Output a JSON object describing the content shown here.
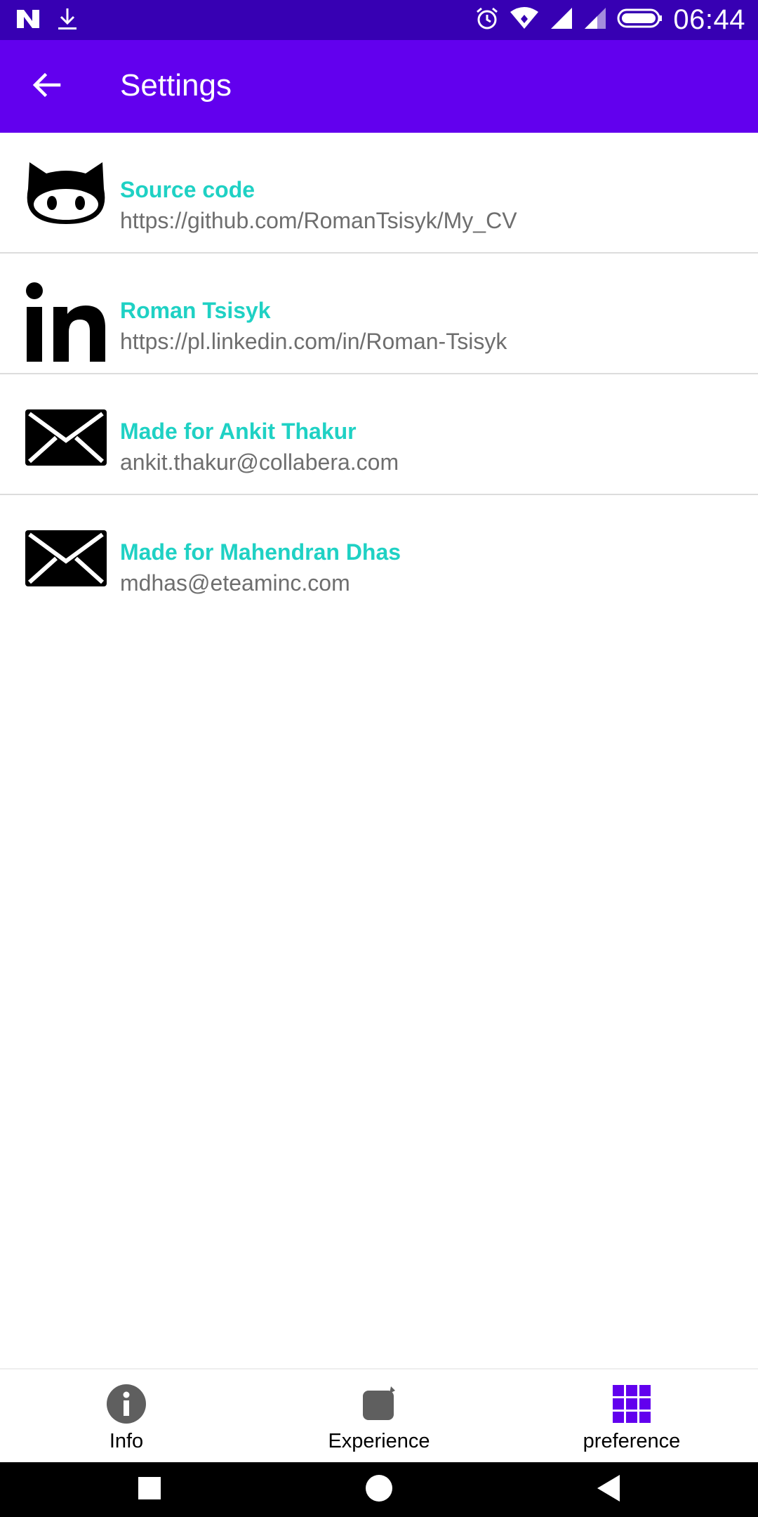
{
  "status_bar": {
    "time": "06:44",
    "icons": [
      "n-logo-icon",
      "download-icon",
      "alarm-icon",
      "wifi-icon",
      "cell-signal-icon",
      "cell-signal-2-icon",
      "battery-icon"
    ]
  },
  "app_bar": {
    "title": "Settings",
    "back_icon": "arrow-back-icon"
  },
  "items": [
    {
      "icon": "github-icon",
      "title": "Source code",
      "subtitle": "https://github.com/RomanTsisyk/My_CV"
    },
    {
      "icon": "linkedin-icon",
      "title": "Roman Tsisyk",
      "subtitle": "https://pl.linkedin.com/in/Roman-Tsisyk"
    },
    {
      "icon": "mail-icon",
      "title": "Made for Ankit Thakur",
      "subtitle": "ankit.thakur@collabera.com"
    },
    {
      "icon": "mail-icon",
      "title": "Made for Mahendran Dhas",
      "subtitle": "mdhas@eteaminc.com"
    }
  ],
  "bottom_nav": [
    {
      "label": "Info",
      "icon": "info-icon",
      "selected": false
    },
    {
      "label": "Experience",
      "icon": "experience-icon",
      "selected": false
    },
    {
      "label": "preference",
      "icon": "grid-icon",
      "selected": true
    }
  ],
  "colors": {
    "status_bar": "#3700b3",
    "app_bar": "#6200ee",
    "accent_title": "#1fd1c4",
    "subtitle": "#6e6e6e",
    "nav_selected": "#6200ee",
    "nav_unselected": "#5f5f5f"
  }
}
